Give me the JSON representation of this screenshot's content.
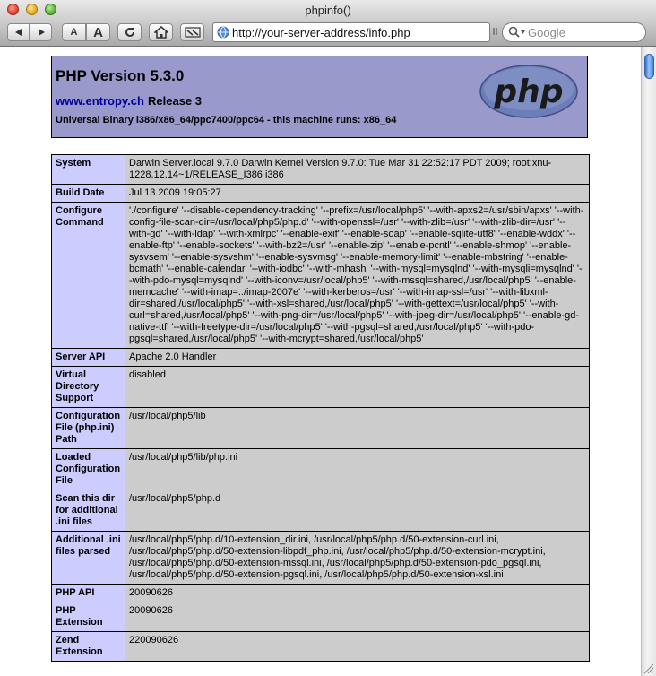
{
  "window": {
    "title": "phpinfo()"
  },
  "toolbar": {
    "text_smaller": "A",
    "text_bigger": "A",
    "url": "http://your-server-address/info.php",
    "search_placeholder": "Google"
  },
  "header": {
    "version": "PHP Version 5.3.0",
    "link": "www.entropy.ch",
    "release": "Release 3",
    "arch": "Universal Binary i386/x86_64/ppc7400/ppc64 - this machine runs: x86_64",
    "logo_text": "php"
  },
  "rows": [
    {
      "label": "System",
      "value": "Darwin Server.local 9.7.0 Darwin Kernel Version 9.7.0: Tue Mar 31 22:52:17 PDT 2009; root:xnu-1228.12.14~1/RELEASE_I386 i386"
    },
    {
      "label": "Build Date",
      "value": "Jul 13 2009 19:05:27"
    },
    {
      "label": "Configure Command",
      "value": "'./configure' '--disable-dependency-tracking' '--prefix=/usr/local/php5' '--with-apxs2=/usr/sbin/apxs' '--with-config-file-scan-dir=/usr/local/php5/php.d' '--with-openssl=/usr' '--with-zlib=/usr' '--with-zlib-dir=/usr' '--with-gd' '--with-ldap' '--with-xmlrpc' '--enable-exif' '--enable-soap' '--enable-sqlite-utf8' '--enable-wddx' '--enable-ftp' '--enable-sockets' '--with-bz2=/usr' '--enable-zip' '--enable-pcntl' '--enable-shmop' '--enable-sysvsem' '--enable-sysvshm' '--enable-sysvmsg' '--enable-memory-limit' '--enable-mbstring' '--enable-bcmath' '--enable-calendar' '--with-iodbc' '--with-mhash' '--with-mysql=mysqlnd' '--with-mysqli=mysqlnd' '--with-pdo-mysql=mysqlnd' '--with-iconv=/usr/local/php5' '--with-mssql=shared,/usr/local/php5' '--enable-memcache' '--with-imap=../imap-2007e' '--with-kerberos=/usr' '--with-imap-ssl=/usr' '--with-libxml-dir=shared,/usr/local/php5' '--with-xsl=shared,/usr/local/php5' '--with-gettext=/usr/local/php5' '--with-curl=shared,/usr/local/php5' '--with-png-dir=/usr/local/php5' '--with-jpeg-dir=/usr/local/php5' '--enable-gd-native-ttf' '--with-freetype-dir=/usr/local/php5' '--with-pgsql=shared,/usr/local/php5' '--with-pdo-pgsql=shared,/usr/local/php5' '--with-mcrypt=shared,/usr/local/php5'"
    },
    {
      "label": "Server API",
      "value": "Apache 2.0 Handler"
    },
    {
      "label": "Virtual Directory Support",
      "value": "disabled"
    },
    {
      "label": "Configuration File (php.ini) Path",
      "value": "/usr/local/php5/lib"
    },
    {
      "label": "Loaded Configuration File",
      "value": "/usr/local/php5/lib/php.ini"
    },
    {
      "label": "Scan this dir for additional .ini files",
      "value": "/usr/local/php5/php.d"
    },
    {
      "label": "Additional .ini files parsed",
      "value": "/usr/local/php5/php.d/10-extension_dir.ini, /usr/local/php5/php.d/50-extension-curl.ini, /usr/local/php5/php.d/50-extension-libpdf_php.ini, /usr/local/php5/php.d/50-extension-mcrypt.ini, /usr/local/php5/php.d/50-extension-mssql.ini, /usr/local/php5/php.d/50-extension-pdo_pgsql.ini, /usr/local/php5/php.d/50-extension-pgsql.ini, /usr/local/php5/php.d/50-extension-xsl.ini"
    },
    {
      "label": "PHP API",
      "value": "20090626"
    },
    {
      "label": "PHP Extension",
      "value": "20090626"
    },
    {
      "label": "Zend Extension",
      "value": "220090626"
    }
  ],
  "colors": {
    "header_bg": "#9999cc",
    "label_bg": "#ccccff",
    "value_bg": "#cccccc",
    "link": "#000099"
  }
}
